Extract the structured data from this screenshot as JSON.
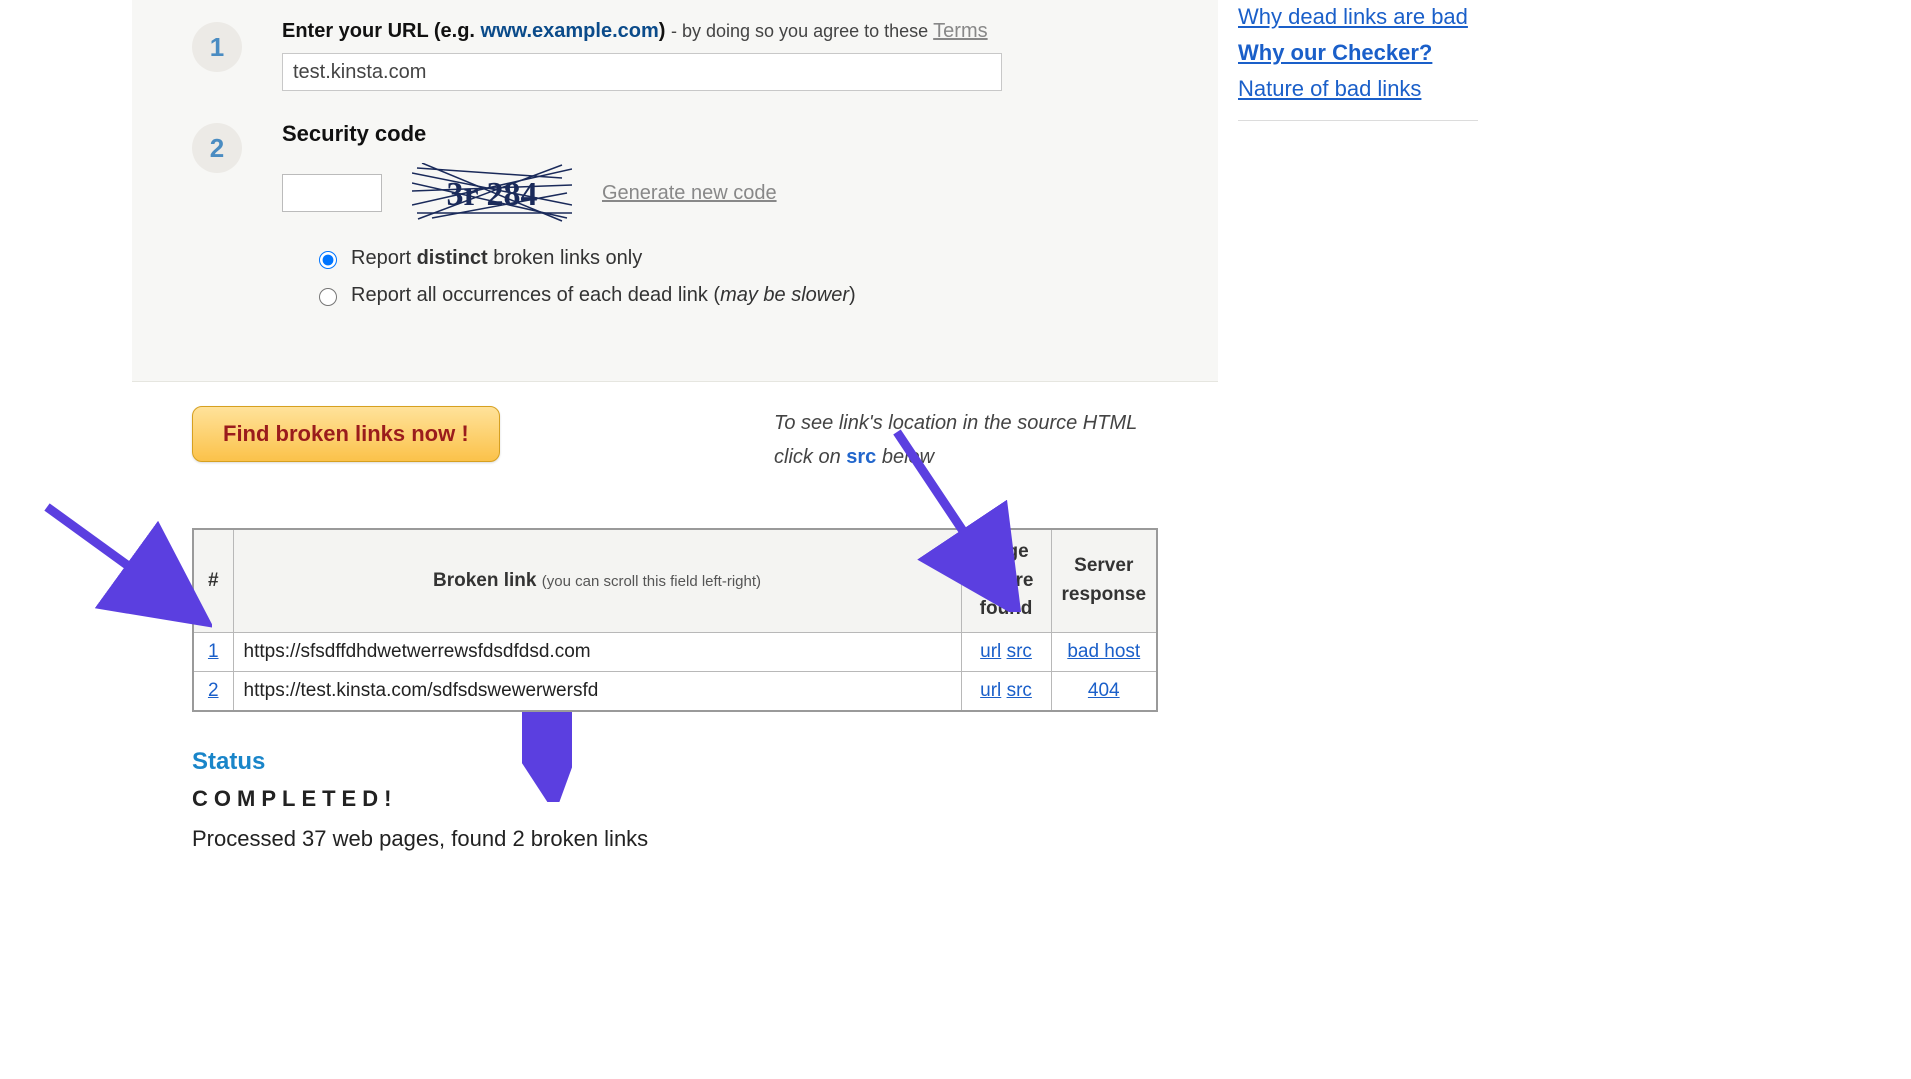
{
  "step1": {
    "badge": "1",
    "label_bold": "Enter your URL (e.g. ",
    "label_url": "www.example.com",
    "label_close": ")",
    "label_by": " - by doing so you agree to these ",
    "terms": "Terms",
    "input_value": "test.kinsta.com"
  },
  "step2": {
    "badge": "2",
    "label": "Security code",
    "captcha_text": "3r 284",
    "generate": "Generate new code",
    "radio_distinct_pre": "Report ",
    "radio_distinct_bold": "distinct",
    "radio_distinct_post": " broken links only",
    "radio_all_pre": "Report all occurrences of each dead link (",
    "radio_all_italic": "may be slower",
    "radio_all_post": ")"
  },
  "find_button": "Find broken links now !",
  "hint": {
    "line1": "To see link's location in the source HTML",
    "line2a": "click on ",
    "line2_src": "src",
    "line2b": " below"
  },
  "table": {
    "col_num": "#",
    "col_link": "Broken link",
    "col_link_sub": "(you can scroll this field left-right)",
    "col_page": "Page where found",
    "col_resp": "Server response",
    "rows": [
      {
        "n": "1",
        "link": "https://sfsdffdhdwetwerrewsfdsdfdsd.com",
        "url": "url",
        "src": "src",
        "resp": "bad host"
      },
      {
        "n": "2",
        "link": "https://test.kinsta.com/sdfsdswewerwersfd",
        "url": "url",
        "src": "src",
        "resp": "404"
      }
    ]
  },
  "status": {
    "title": "Status",
    "completed": "COMPLETED!",
    "summary": "Processed 37 web pages, found 2 broken links"
  },
  "sidebar": {
    "link1": "Why dead links are bad",
    "link2": "Why our Checker?",
    "link3": "Nature of bad links"
  }
}
